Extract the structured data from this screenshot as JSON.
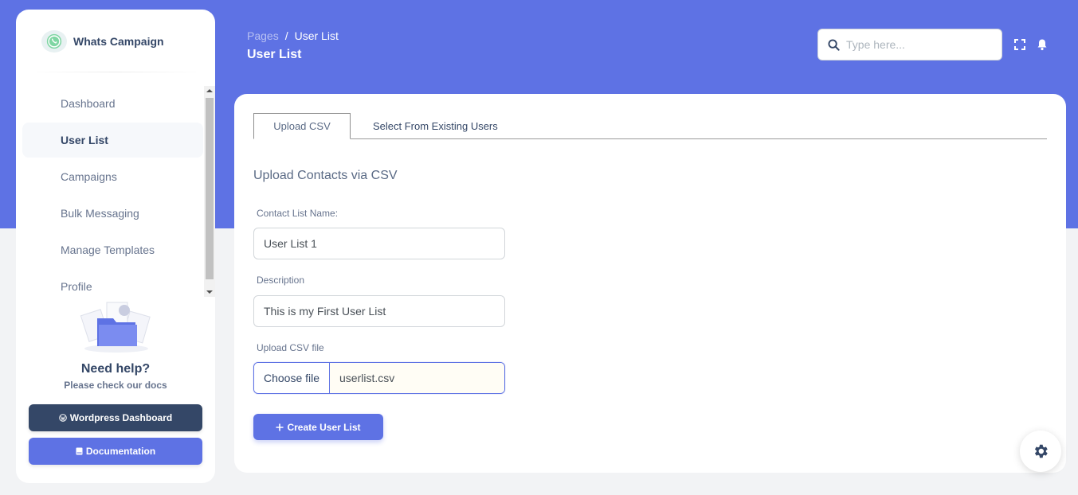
{
  "brand": {
    "name": "Whats Campaign",
    "logo_icon": "whatsapp-icon"
  },
  "sidebar": {
    "items": [
      {
        "label": "Dashboard",
        "active": false
      },
      {
        "label": "User List",
        "active": true
      },
      {
        "label": "Campaigns",
        "active": false
      },
      {
        "label": "Bulk Messaging",
        "active": false
      },
      {
        "label": "Manage Templates",
        "active": false
      },
      {
        "label": "Profile",
        "active": false
      }
    ],
    "help": {
      "title": "Need help?",
      "subtitle": "Please check our docs"
    },
    "buttons": {
      "wordpress": "Wordpress Dashboard",
      "documentation": "Documentation"
    }
  },
  "header": {
    "breadcrumb": [
      "Pages",
      "User List"
    ],
    "separator": "/",
    "title": "User List",
    "search_placeholder": "Type here..."
  },
  "main": {
    "tabs": [
      {
        "label": "Upload CSV",
        "active": true
      },
      {
        "label": "Select From Existing Users",
        "active": false
      }
    ],
    "section_title": "Upload Contacts via CSV",
    "fields": {
      "contact_list_name": {
        "label": "Contact List Name:",
        "value": "User List 1"
      },
      "description": {
        "label": "Description",
        "value": "This is my First User List"
      },
      "csv_file": {
        "label": "Upload CSV file",
        "button": "Choose file",
        "filename": "userlist.csv"
      }
    },
    "create_button": "Create User List"
  },
  "colors": {
    "primary": "#5e72e4",
    "dark": "#344767",
    "muted": "#67748e"
  }
}
